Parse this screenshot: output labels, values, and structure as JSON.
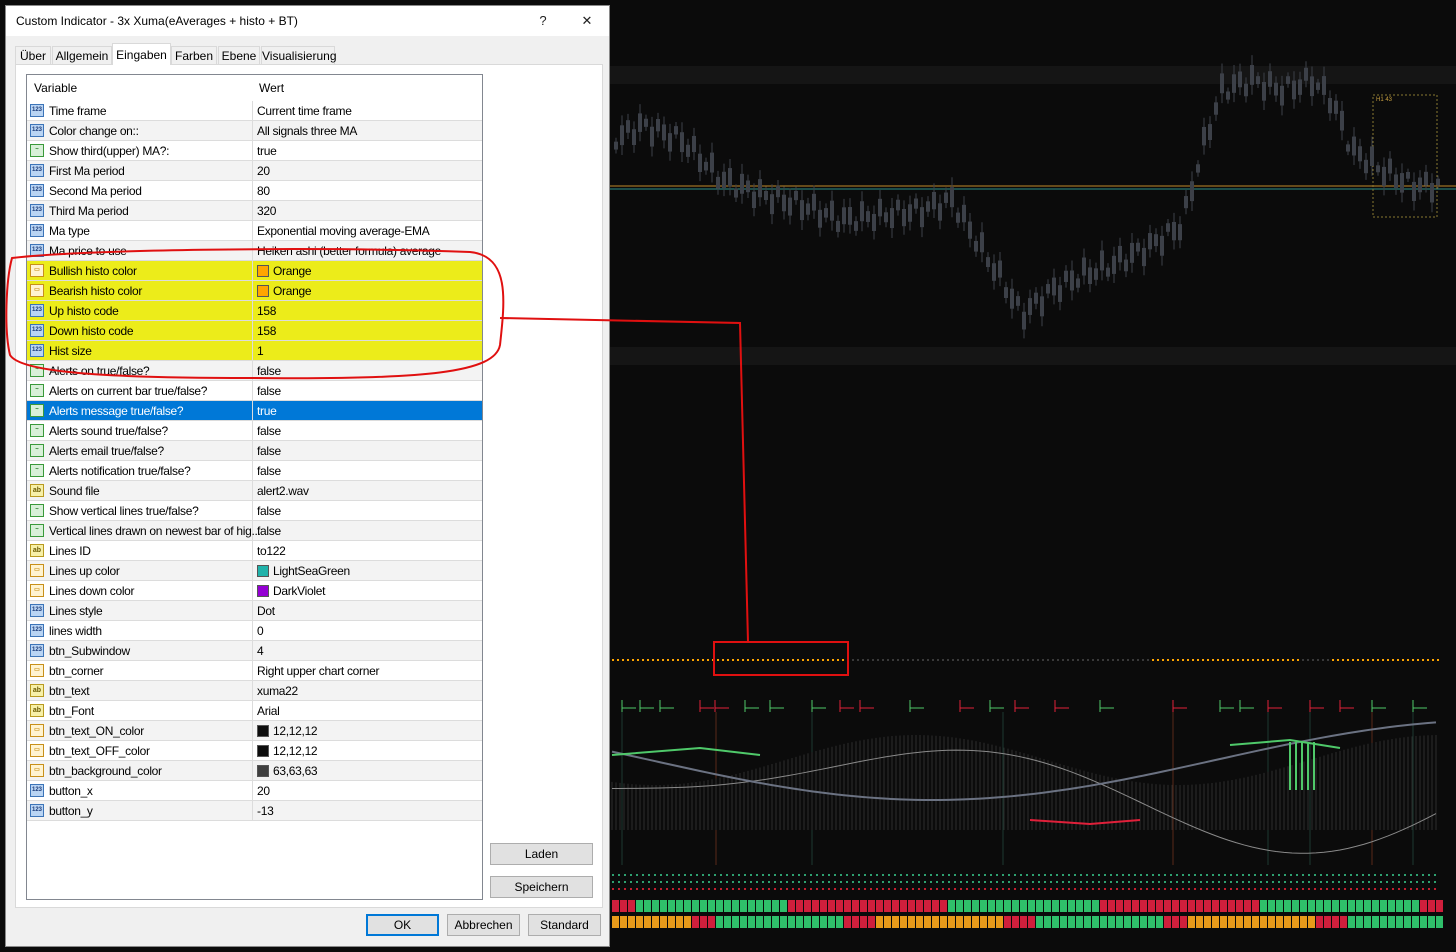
{
  "dialog": {
    "title": "Custom Indicator - 3x Xuma(eAverages + histo + BT)",
    "help": "?",
    "close": "✕",
    "tabs": [
      "Über",
      "Allgemein",
      "Eingaben",
      "Farben",
      "Ebene",
      "Visualisierung"
    ],
    "active_tab": 2,
    "columns": {
      "variable": "Variable",
      "value": "Wert"
    },
    "buttons": {
      "load": "Laden",
      "save": "Speichern",
      "ok": "OK",
      "cancel": "Abbrechen",
      "default": "Standard"
    }
  },
  "inputs": [
    {
      "name": "Time frame",
      "value": "Current time frame",
      "type": "num"
    },
    {
      "name": "Color change on::",
      "value": "All signals three MA",
      "type": "num"
    },
    {
      "name": "Show third(upper) MA?:",
      "value": "true",
      "type": "bool"
    },
    {
      "name": "First Ma period",
      "value": "20",
      "type": "num"
    },
    {
      "name": "Second Ma period",
      "value": "80",
      "type": "num"
    },
    {
      "name": "Third Ma period",
      "value": "320",
      "type": "num"
    },
    {
      "name": "Ma type",
      "value": "Exponential moving average-EMA",
      "type": "num"
    },
    {
      "name": "Ma price to use",
      "value": "Heiken ashi (better formula) average",
      "type": "num"
    },
    {
      "name": "Bullish histo  color",
      "value": "Orange",
      "type": "clr",
      "color": "#ffa500",
      "highlight": true
    },
    {
      "name": "Bearish histo  color",
      "value": "Orange",
      "type": "clr",
      "color": "#ffa500",
      "highlight": true
    },
    {
      "name": "Up histo code",
      "value": "158",
      "type": "num",
      "highlight": true
    },
    {
      "name": "Down histo code",
      "value": "158",
      "type": "num",
      "highlight": true
    },
    {
      "name": "Hist size",
      "value": "1",
      "type": "num",
      "highlight": true
    },
    {
      "name": "Alerts on true/false?",
      "value": "false",
      "type": "bool"
    },
    {
      "name": "Alerts on current bar true/false?",
      "value": "false",
      "type": "bool"
    },
    {
      "name": "Alerts message true/false?",
      "value": "true",
      "type": "bool",
      "selected": true
    },
    {
      "name": "Alerts sound true/false?",
      "value": "false",
      "type": "bool"
    },
    {
      "name": "Alerts email true/false?",
      "value": "false",
      "type": "bool"
    },
    {
      "name": "Alerts notification true/false?",
      "value": "false",
      "type": "bool"
    },
    {
      "name": "Sound file",
      "value": "alert2.wav",
      "type": "str"
    },
    {
      "name": "Show vertical lines true/false?",
      "value": "false",
      "type": "bool"
    },
    {
      "name": "Vertical lines drawn on newest bar of hig...",
      "value": "false",
      "type": "bool"
    },
    {
      "name": "Lines ID",
      "value": "to122",
      "type": "str"
    },
    {
      "name": "Lines up color",
      "value": "LightSeaGreen",
      "type": "clr",
      "color": "#20b2aa"
    },
    {
      "name": "Lines down color",
      "value": "DarkViolet",
      "type": "clr",
      "color": "#9400d3"
    },
    {
      "name": "Lines style",
      "value": "Dot",
      "type": "num"
    },
    {
      "name": "lines width",
      "value": "0",
      "type": "num"
    },
    {
      "name": "btn_Subwindow",
      "value": "4",
      "type": "num"
    },
    {
      "name": "btn_corner",
      "value": "Right upper chart corner",
      "type": "clr"
    },
    {
      "name": "btn_text",
      "value": "xuma22",
      "type": "str"
    },
    {
      "name": "btn_Font",
      "value": "Arial",
      "type": "str"
    },
    {
      "name": "btn_text_ON_color",
      "value": "12,12,12",
      "type": "clr",
      "color": "#0c0c0c"
    },
    {
      "name": "btn_text_OFF_color",
      "value": "12,12,12",
      "type": "clr",
      "color": "#0c0c0c"
    },
    {
      "name": "btn_background_color",
      "value": "63,63,63",
      "type": "clr",
      "color": "#3f3f3f"
    },
    {
      "name": "button_x",
      "value": "20",
      "type": "num"
    },
    {
      "name": "button_y",
      "value": "-13",
      "type": "num"
    }
  ],
  "colors": {
    "highlight": "#ecec1a",
    "selection": "#0078d7",
    "annotation": "#e01010",
    "chart_bg": "#0b0b0b",
    "candle": "#3c4048",
    "histo_dot": "#ffa500",
    "ma_green": "#4fc96a",
    "ma_red": "#e0203a",
    "ma_gray": "#6b7282"
  },
  "chart_label": "H1 43"
}
